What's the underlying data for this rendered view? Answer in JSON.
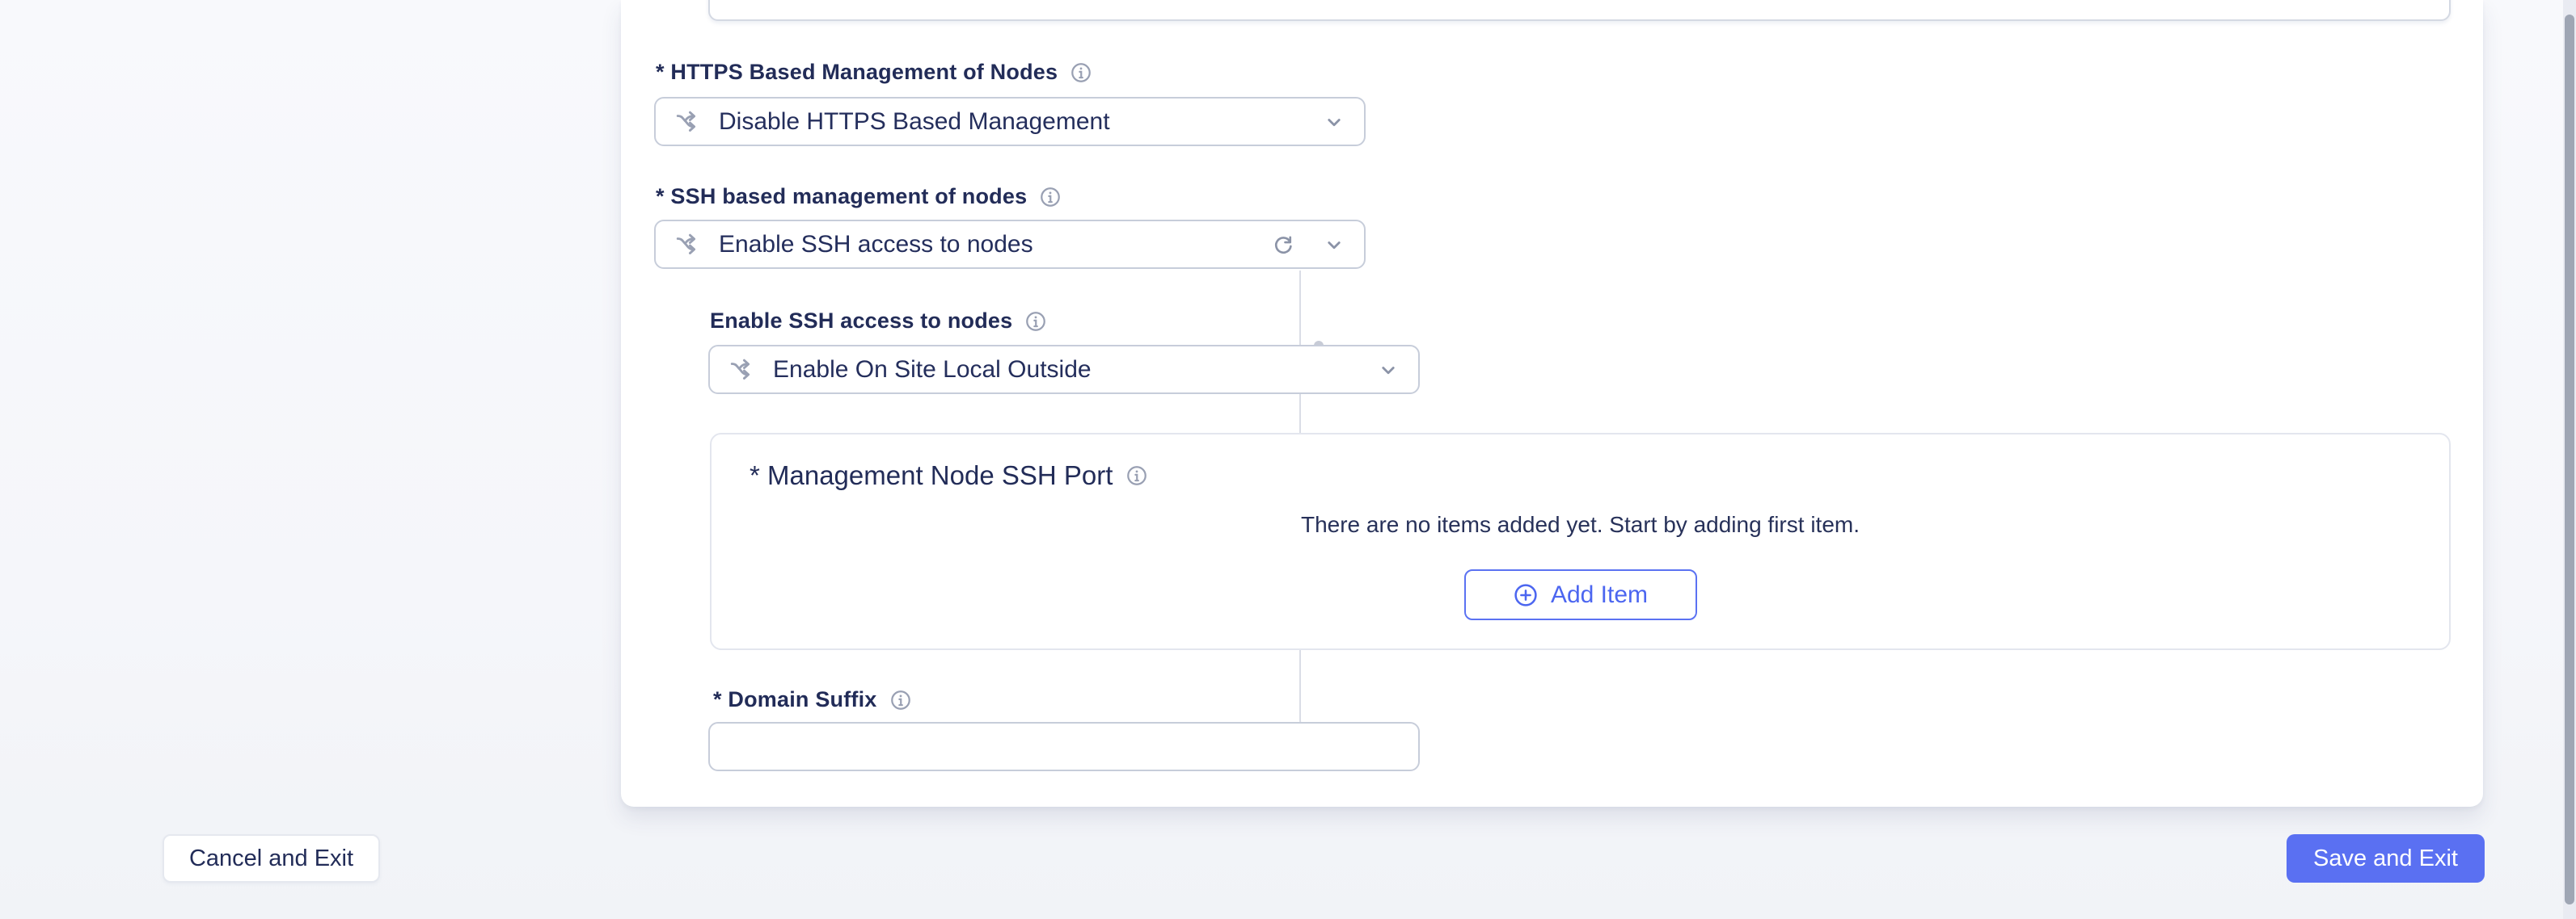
{
  "form": {
    "https_management": {
      "label": "* HTTPS Based Management of Nodes",
      "value": "Disable HTTPS Based Management"
    },
    "ssh_management": {
      "label": "* SSH based management of nodes",
      "value": "Enable SSH access to nodes"
    },
    "ssh_access": {
      "label": "Enable SSH access to nodes",
      "value": "Enable On Site Local Outside"
    },
    "ssh_port_list": {
      "label": "* Management Node SSH Port",
      "empty_message": "There are no items added yet. Start by adding first item.",
      "add_item_label": "Add Item"
    },
    "domain_suffix": {
      "label": "* Domain Suffix",
      "value": ""
    }
  },
  "footer": {
    "cancel_label": "Cancel and Exit",
    "save_label": "Save and Exit"
  },
  "colors": {
    "accent_blue": "#5a70f2",
    "text_navy": "#232d5b",
    "field_border": "#c7cdda",
    "icon_gray": "#99a0b3",
    "tree_line": "#dadde6"
  },
  "icons": {
    "field_prefix": "branch-icon",
    "label_suffix": "info-icon",
    "ssh_field_action": "refresh-icon",
    "dropdown_caret": "chevron-down-icon",
    "add_item": "plus-circle-icon"
  }
}
